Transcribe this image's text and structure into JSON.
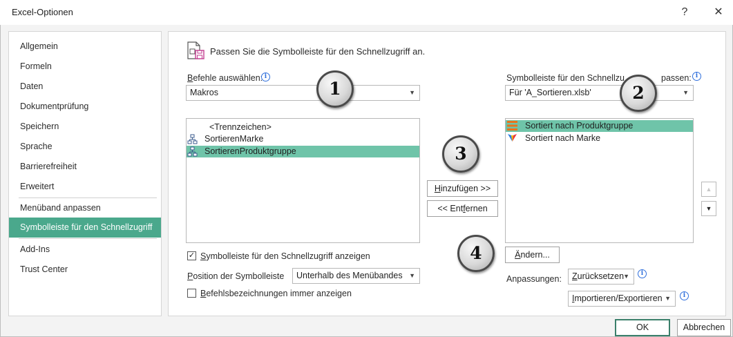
{
  "window": {
    "title": "Excel-Optionen",
    "help": "?",
    "close": "✕"
  },
  "nav": {
    "items": [
      {
        "label": "Allgemein"
      },
      {
        "label": "Formeln"
      },
      {
        "label": "Daten"
      },
      {
        "label": "Dokumentprüfung"
      },
      {
        "label": "Speichern"
      },
      {
        "label": "Sprache"
      },
      {
        "label": "Barrierefreiheit"
      },
      {
        "label": "Erweitert"
      },
      {
        "label": "Menüband anpassen"
      },
      {
        "label": "Symbolleiste für den Schnellzugriff"
      },
      {
        "label": "Add-Ins"
      },
      {
        "label": "Trust Center"
      }
    ],
    "selected": "Symbolleiste für den Schnellzugriff"
  },
  "main": {
    "header": "Passen Sie die Symbolleiste für den Schnellzugriff an.",
    "commands_label_underlined": "B",
    "commands_label_rest": "efehle auswählen:",
    "commands_value": "Makros",
    "commands_list": [
      "<Trennzeichen>",
      "SortierenMarke",
      "SortierenProduktgruppe"
    ],
    "qat_label": "Symbolleiste für den Schnellzu",
    "qat_label_end": "passen:",
    "qat_value": "Für 'A_Sortieren.xlsb'",
    "qat_list": [
      "Sortiert nach Produktgruppe",
      "Sortiert nach Marke"
    ],
    "add_button_underlined": "H",
    "add_button_rest": "inzufügen >>",
    "remove_button_start": "<< Ent",
    "remove_button_underlined": "f",
    "remove_button_rest": "ernen",
    "modify_button_underlined": "Ä",
    "modify_button_rest": "ndern...",
    "show_qat_label_underlined": "S",
    "show_qat_label_rest": "ymbolleiste für den Schnellzugriff anzeigen",
    "show_qat_checked": "✓",
    "position_label_underlined": "P",
    "position_label_rest": "osition der Symbolleiste",
    "position_value": "Unterhalb des Menübandes",
    "always_show_labels_underlined": "B",
    "always_show_labels_rest": "efehlsbezeichnungen immer anzeigen",
    "customizations_label": "Anpassungen:",
    "reset_underlined": "Z",
    "reset_rest": "urücksetzen",
    "import_export_underlined": "I",
    "import_export_rest": "mportieren/Exportieren"
  },
  "callouts": [
    "1",
    "2",
    "3",
    "4"
  ],
  "footer": {
    "ok": "OK",
    "cancel": "Abbrechen"
  },
  "icons": {
    "info": "i",
    "dropdown": "▼",
    "move_up": "▲",
    "move_down": "▼"
  },
  "colors": {
    "accent": "#4aa88c",
    "list_selection": "#6fc4a9",
    "info": "#2f6fdc"
  }
}
